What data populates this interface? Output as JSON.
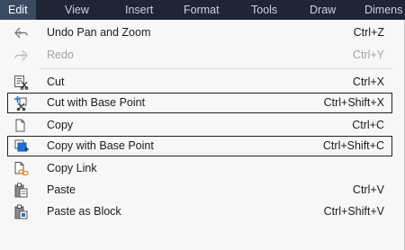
{
  "menubar": {
    "items": [
      {
        "label": "Edit"
      },
      {
        "label": "View"
      },
      {
        "label": "Insert"
      },
      {
        "label": "Format"
      },
      {
        "label": "Tools"
      },
      {
        "label": "Draw"
      },
      {
        "label": "Dimens"
      }
    ]
  },
  "menu": {
    "items": [
      {
        "label": "Undo Pan and Zoom",
        "shortcut": "Ctrl+Z",
        "icon": "undo-icon",
        "enabled": true
      },
      {
        "label": "Redo",
        "shortcut": "Ctrl+Y",
        "icon": "redo-icon",
        "enabled": false
      },
      {
        "label": "Cut",
        "shortcut": "Ctrl+X",
        "icon": "cut-icon",
        "enabled": true
      },
      {
        "label": "Cut with Base Point",
        "shortcut": "Ctrl+Shift+X",
        "icon": "cut-base-point-icon",
        "enabled": true
      },
      {
        "label": "Copy",
        "shortcut": "Ctrl+C",
        "icon": "copy-icon",
        "enabled": true
      },
      {
        "label": "Copy with Base Point",
        "shortcut": "Ctrl+Shift+C",
        "icon": "copy-base-point-icon",
        "enabled": true
      },
      {
        "label": "Copy Link",
        "shortcut": "",
        "icon": "copy-link-icon",
        "enabled": true
      },
      {
        "label": "Paste",
        "shortcut": "Ctrl+V",
        "icon": "paste-icon",
        "enabled": true
      },
      {
        "label": "Paste as Block",
        "shortcut": "Ctrl+Shift+V",
        "icon": "paste-block-icon",
        "enabled": true
      }
    ]
  },
  "colors": {
    "menubar_bg": "#1e2633",
    "menubar_active_bg": "#3a4a60",
    "menu_bg": "#f7f7f7",
    "accent_blue": "#1f6fd1",
    "accent_orange": "#e08a1e"
  }
}
